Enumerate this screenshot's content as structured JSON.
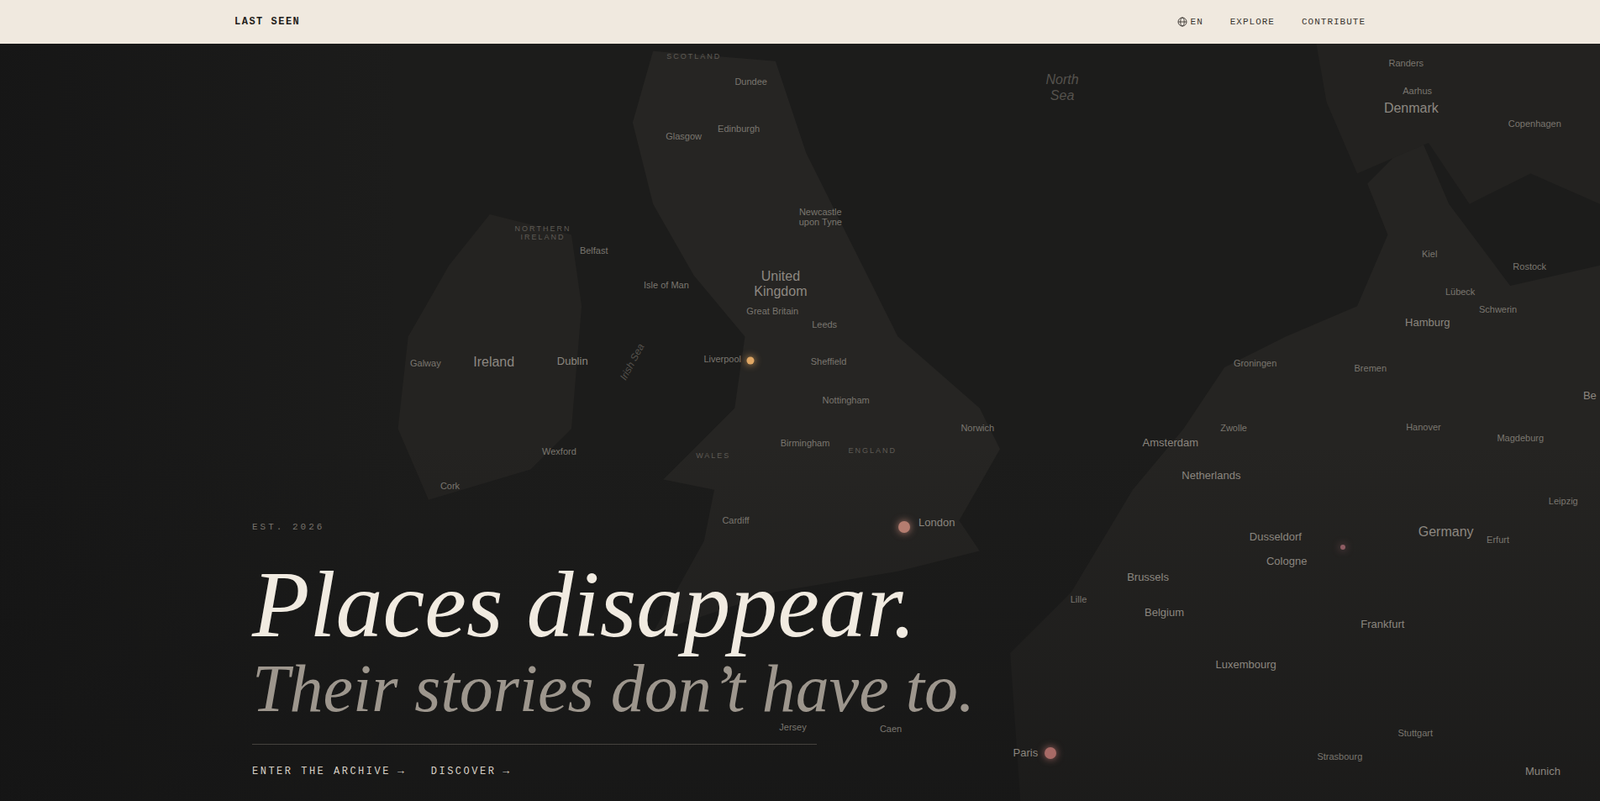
{
  "header": {
    "logo": "LAST SEEN",
    "language": "EN",
    "nav": [
      "EXPLORE",
      "CONTRIBUTE"
    ]
  },
  "hero": {
    "eyebrow": "EST. 2026",
    "headline": "Places disappear.",
    "subline": "Their stories don’t have to.",
    "actions": [
      {
        "label": "ENTER THE ARCHIVE",
        "arrow": "→"
      },
      {
        "label": "DISCOVER",
        "arrow": "→"
      }
    ]
  },
  "map": {
    "labels": [
      {
        "text": "SCOTLAND",
        "kind": "region"
      },
      {
        "text": "Dundee",
        "kind": "minor"
      },
      {
        "text": "Edinburgh",
        "kind": "minor"
      },
      {
        "text": "Glasgow",
        "kind": "minor"
      },
      {
        "text": "North Sea",
        "kind": "sea"
      },
      {
        "text": "Newcastle upon Tyne",
        "kind": "minor"
      },
      {
        "text": "NORTHERN IRELAND",
        "kind": "region"
      },
      {
        "text": "Belfast",
        "kind": "minor"
      },
      {
        "text": "Isle of Man",
        "kind": "minor"
      },
      {
        "text": "United Kingdom",
        "kind": "country"
      },
      {
        "text": "Great Britain",
        "kind": "minor"
      },
      {
        "text": "Leeds",
        "kind": "minor"
      },
      {
        "text": "Galway",
        "kind": "minor"
      },
      {
        "text": "Ireland",
        "kind": "country"
      },
      {
        "text": "Dublin",
        "kind": "major"
      },
      {
        "text": "Irish Sea",
        "kind": "strait"
      },
      {
        "text": "Liverpool",
        "kind": "minor"
      },
      {
        "text": "Sheffield",
        "kind": "minor"
      },
      {
        "text": "Nottingham",
        "kind": "minor"
      },
      {
        "text": "Norwich",
        "kind": "minor"
      },
      {
        "text": "Birmingham",
        "kind": "minor"
      },
      {
        "text": "WALES",
        "kind": "region"
      },
      {
        "text": "ENGLAND",
        "kind": "region"
      },
      {
        "text": "Wexford",
        "kind": "minor"
      },
      {
        "text": "Cork",
        "kind": "minor"
      },
      {
        "text": "Cardiff",
        "kind": "minor"
      },
      {
        "text": "London",
        "kind": "major"
      },
      {
        "text": "Jersey",
        "kind": "minor"
      },
      {
        "text": "Caen",
        "kind": "minor"
      },
      {
        "text": "Paris",
        "kind": "major"
      },
      {
        "text": "Lille",
        "kind": "minor"
      },
      {
        "text": "Randers",
        "kind": "minor"
      },
      {
        "text": "Aarhus",
        "kind": "minor"
      },
      {
        "text": "Denmark",
        "kind": "country"
      },
      {
        "text": "Copenhagen",
        "kind": "minor"
      },
      {
        "text": "Kiel",
        "kind": "minor"
      },
      {
        "text": "Rostock",
        "kind": "minor"
      },
      {
        "text": "Lübeck",
        "kind": "minor"
      },
      {
        "text": "Schwerin",
        "kind": "minor"
      },
      {
        "text": "Hamburg",
        "kind": "major"
      },
      {
        "text": "Bremen",
        "kind": "minor"
      },
      {
        "text": "Groningen",
        "kind": "minor"
      },
      {
        "text": "Zwolle",
        "kind": "minor"
      },
      {
        "text": "Hanover",
        "kind": "minor"
      },
      {
        "text": "Magdeburg",
        "kind": "minor"
      },
      {
        "text": "Amsterdam",
        "kind": "major"
      },
      {
        "text": "Netherlands",
        "kind": "major"
      },
      {
        "text": "Leipzig",
        "kind": "minor"
      },
      {
        "text": "Germany",
        "kind": "country"
      },
      {
        "text": "Erfurt",
        "kind": "minor"
      },
      {
        "text": "Dusseldorf",
        "kind": "major"
      },
      {
        "text": "Cologne",
        "kind": "major"
      },
      {
        "text": "Brussels",
        "kind": "major"
      },
      {
        "text": "Belgium",
        "kind": "major"
      },
      {
        "text": "Frankfurt",
        "kind": "major"
      },
      {
        "text": "Luxembourg",
        "kind": "major"
      },
      {
        "text": "Stuttgart",
        "kind": "minor"
      },
      {
        "text": "Strasbourg",
        "kind": "minor"
      },
      {
        "text": "Munich",
        "kind": "major"
      },
      {
        "text": "Be",
        "kind": "major"
      }
    ],
    "pins": [
      {
        "color": "#e0a764",
        "kind": "small"
      },
      {
        "color": "#b47d70",
        "kind": "large"
      },
      {
        "color": "#8e5c63",
        "kind": "tiny"
      },
      {
        "color": "#a86a66",
        "kind": "large"
      }
    ]
  }
}
